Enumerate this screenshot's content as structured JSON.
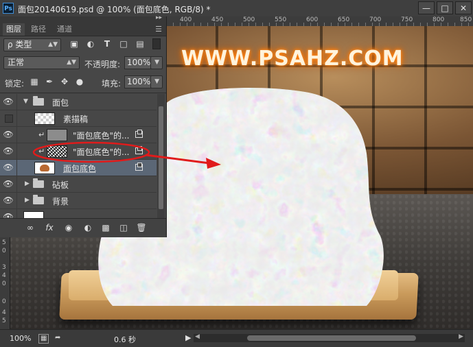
{
  "window": {
    "app_icon": "Ps",
    "title": "面包20140619.psd @ 100% (面包底色, RGB/8) *",
    "controls": {
      "minimize": "—",
      "restore": "□",
      "close": "✕"
    }
  },
  "canvas": {
    "watermark": "WWW.PSAHZ.COM",
    "ruler_top": [
      "400",
      "450",
      "500",
      "550",
      "600",
      "650",
      "700",
      "750",
      "800",
      "850"
    ],
    "ruler_left": [
      "5",
      "0",
      "3",
      "4",
      "0",
      "0",
      "4",
      "5"
    ]
  },
  "layers_panel": {
    "tabs": [
      "图层",
      "路径",
      "通道"
    ],
    "active_tab": "图层",
    "menu_icon": "panel-menu-icon",
    "filter": {
      "label": "ρ 类型",
      "icons": [
        "image-filter-icon",
        "adjustment-filter-icon",
        "type-filter-icon",
        "shape-filter-icon",
        "smart-object-filter-icon"
      ]
    },
    "blend_mode": "正常",
    "opacity_label": "不透明度:",
    "opacity_value": "100%",
    "lock_label": "锁定:",
    "fill_label": "填充:",
    "fill_value": "100%",
    "layers": [
      {
        "name": "面包",
        "type": "group",
        "visible": true,
        "expanded": true
      },
      {
        "name": "素描稿",
        "type": "layer",
        "visible": false,
        "thumb": "checker"
      },
      {
        "name": "\"面包底色\"的...",
        "type": "smart",
        "visible": true,
        "clipped": true,
        "thumb": "gray"
      },
      {
        "name": "\"面包底色\"的...",
        "type": "smart",
        "visible": true,
        "clipped": true,
        "thumb": "noise"
      },
      {
        "name": "面包底色",
        "type": "smart",
        "visible": true,
        "selected": true,
        "thumb": "bread"
      },
      {
        "name": "砧板",
        "type": "group",
        "visible": true,
        "expanded": false
      },
      {
        "name": "背景",
        "type": "group",
        "visible": true,
        "expanded": false
      }
    ],
    "footer_icons": [
      "link-layers-icon",
      "fx-icon",
      "add-mask-icon",
      "adjustment-layer-icon",
      "new-group-icon",
      "new-layer-icon",
      "delete-layer-icon"
    ]
  },
  "status": {
    "zoom": "100%",
    "timing": "0.6 秒"
  },
  "colors": {
    "selection": "#5b6776",
    "annotation": "#e01b1b",
    "watermark_glow": "#ff7a00"
  }
}
